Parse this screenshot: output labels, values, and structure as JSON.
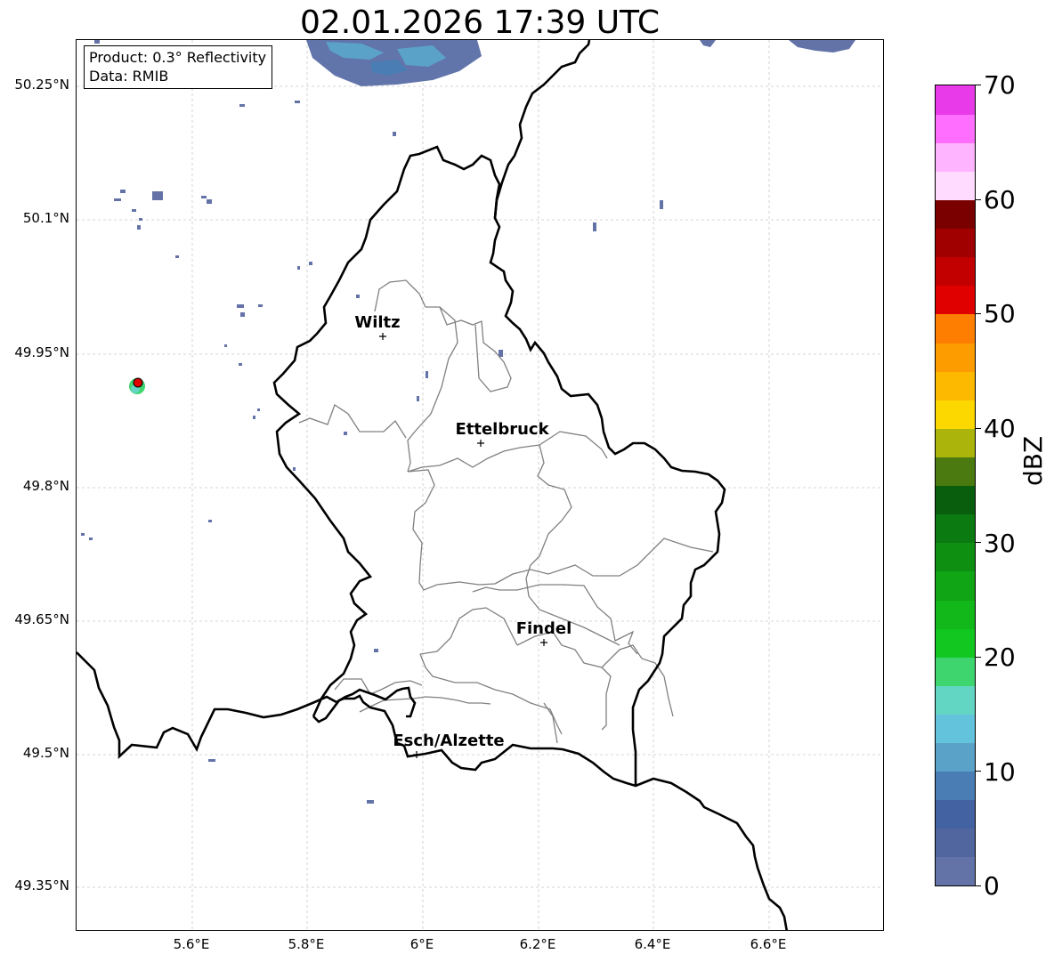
{
  "title": "02.01.2026 17:39 UTC",
  "info": {
    "product": "Product: 0.3° Reflectivity",
    "source": "Data: RMIB"
  },
  "lat_labels": [
    "50.25°N",
    "50.1°N",
    "49.95°N",
    "49.8°N",
    "49.65°N",
    "49.5°N",
    "49.35°N"
  ],
  "lon_labels": [
    "5.6°E",
    "5.8°E",
    "6°E",
    "6.2°E",
    "6.4°E",
    "6.6°E"
  ],
  "cities": [
    {
      "name": "Wiltz"
    },
    {
      "name": "Ettelbruck"
    },
    {
      "name": "Findel"
    },
    {
      "name": "Esch/Alzette"
    }
  ],
  "colorbar": {
    "unit": "dBZ",
    "ticks": [
      "0",
      "10",
      "20",
      "30",
      "40",
      "50",
      "60",
      "70"
    ],
    "colors": [
      "#6373a8",
      "#51669f",
      "#4262a2",
      "#4a7db3",
      "#5ba2c8",
      "#63c3dc",
      "#62d6c3",
      "#3fd56e",
      "#12c71f",
      "#12b81a",
      "#10a514",
      "#0e8f12",
      "#0b7a10",
      "#085e0d",
      "#4a7a10",
      "#aab40a",
      "#fdd800",
      "#fdb800",
      "#fd9c00",
      "#fd7e00",
      "#e00000",
      "#c20000",
      "#a00000",
      "#7a0000",
      "#ffdcff",
      "#ffb4ff",
      "#ff6eff",
      "#e83ae8"
    ]
  },
  "colors": {
    "border_national": "#000000",
    "border_cantonal": "#808080",
    "radar_echo": "#6373a8",
    "radar_site": "#e00000"
  }
}
